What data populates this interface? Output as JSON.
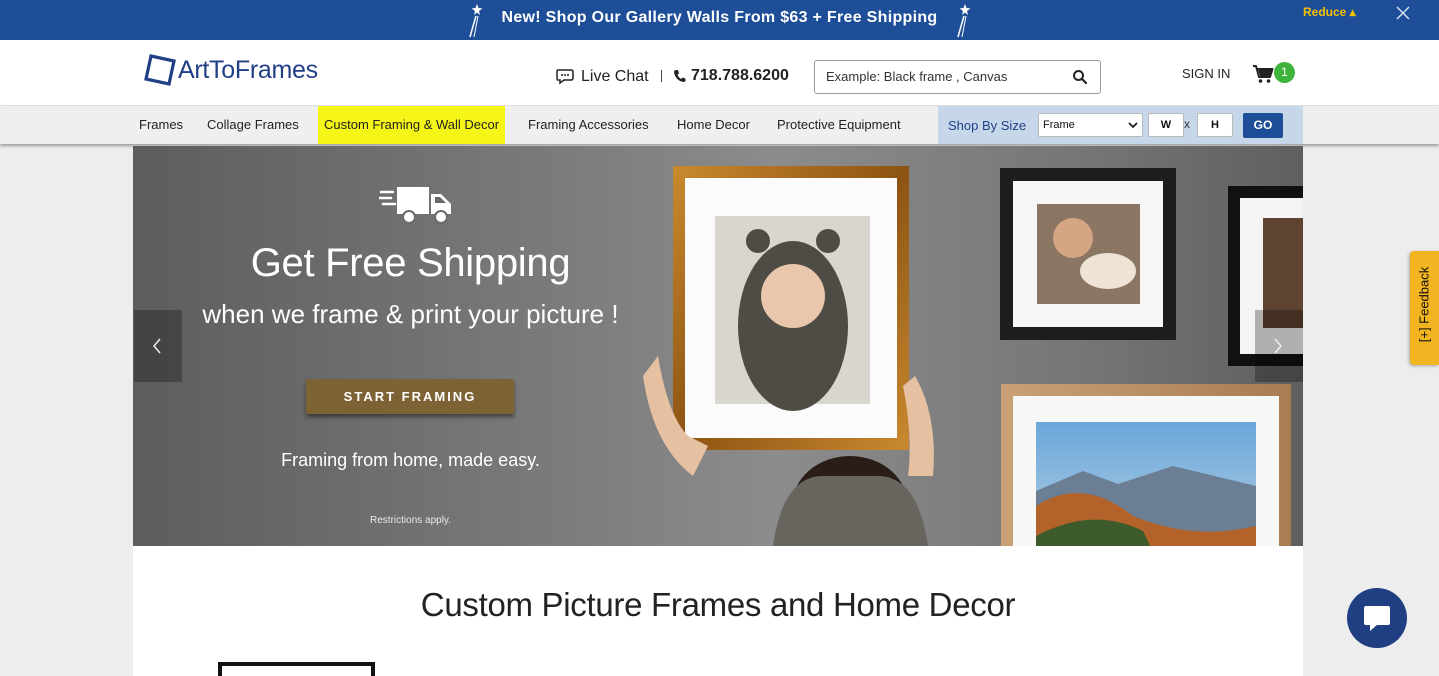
{
  "promo": {
    "text": "New! Shop Our Gallery Walls From $63 + Free Shipping",
    "reduce_label": "Reduce ▴"
  },
  "header": {
    "logo_text": "ArtToFrames",
    "live_chat_label": "Live Chat",
    "phone": "718.788.6200",
    "search_placeholder": "Example: Black frame , Canvas",
    "sign_in_label": "SIGN IN",
    "cart_count": "1"
  },
  "nav": {
    "items": [
      {
        "label": "Frames"
      },
      {
        "label": "Collage Frames"
      },
      {
        "label": "Custom Framing & Wall Decor"
      },
      {
        "label": "Framing Accessories"
      },
      {
        "label": "Home Decor"
      },
      {
        "label": "Protective Equipment"
      }
    ],
    "shop_by_size": {
      "label": "Shop By Size",
      "select_value": "Frame",
      "width_placeholder": "W",
      "separator": "x",
      "height_placeholder": "H",
      "go_label": "GO"
    }
  },
  "hero": {
    "title": "Get Free Shipping",
    "subtitle": "when we frame & print your picture !",
    "button_label": "START FRAMING",
    "tagline": "Framing from home, made easy.",
    "note": "Restrictions apply."
  },
  "content": {
    "title": "Custom Picture Frames and Home Decor"
  },
  "feedback": {
    "label": "[+] Feedback"
  },
  "colors": {
    "brand_blue": "#1f4e99",
    "highlight_yellow": "#f5f517",
    "cart_badge_green": "#3db33b",
    "hero_button_gold": "#7d6334",
    "feedback_orange": "#f3b421"
  },
  "icons": [
    "sparkle-icon",
    "close-icon",
    "chat-bubble-icon",
    "phone-icon",
    "search-icon",
    "cart-icon",
    "truck-icon",
    "chevron-left-icon",
    "chevron-right-icon",
    "chat-icon"
  ]
}
